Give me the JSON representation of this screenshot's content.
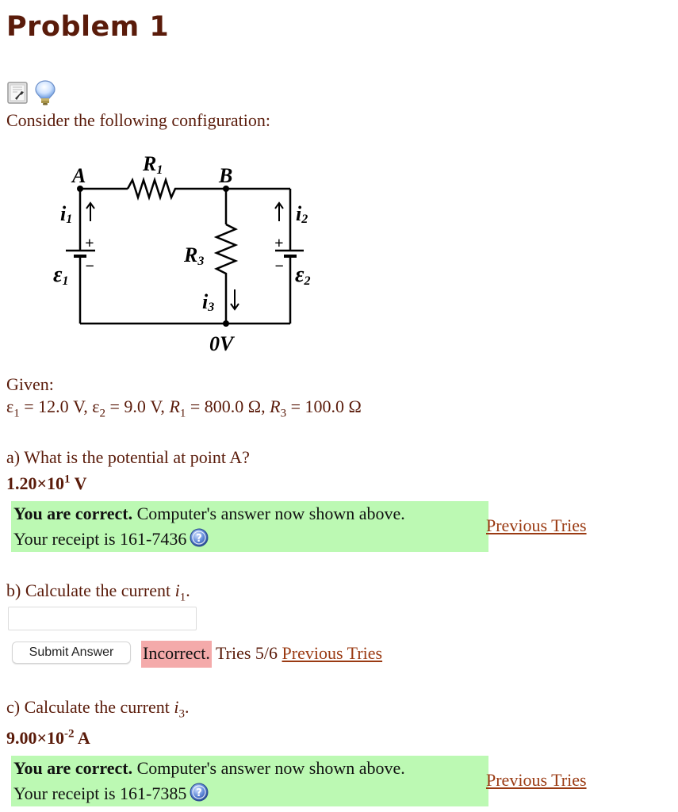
{
  "page": {
    "title": "Problem 1",
    "icons": [
      "tools-icon",
      "lightbulb-hint-icon"
    ],
    "intro": "Consider the following configuration:"
  },
  "circuit": {
    "labels": {
      "node_a": "A",
      "node_b": "B",
      "r1": "R",
      "r1_sub": "1",
      "r3": "R",
      "r3_sub": "3",
      "i1": "i",
      "i1_sub": "1",
      "i2": "i",
      "i2_sub": "2",
      "i3": "i",
      "i3_sub": "3",
      "e1": "ε",
      "e1_sub": "1",
      "e2": "ε",
      "e2_sub": "2",
      "ground": "0V",
      "plus": "+",
      "minus": "−"
    }
  },
  "given": {
    "label": "Given:",
    "values": [
      {
        "sym": "ε",
        "sub": "1",
        "rest": " = 12.0 V, "
      },
      {
        "sym": "ε",
        "sub": "2",
        "rest": " = 9.0 V, "
      },
      {
        "sym": "R",
        "sub": "1",
        "rest": " = 800.0 Ω, "
      },
      {
        "sym": "R",
        "sub": "3",
        "rest": " = 100.0 Ω"
      }
    ]
  },
  "questions": {
    "a": {
      "prompt": "a) What is the potential at point A?",
      "answer_mantissa": "1.20×10",
      "answer_exp": "1",
      "answer_unit": " V",
      "feedback_bold": "You are correct.",
      "feedback_text": " Computer's answer now shown above.",
      "receipt": "Your receipt is 161-7436",
      "previous_tries": "Previous Tries"
    },
    "b": {
      "prompt_pre": "b) Calculate the current ",
      "prompt_var": "i",
      "prompt_sub": "1",
      "prompt_post": ".",
      "input_value": "",
      "submit_label": "Submit Answer",
      "status": "Incorrect.",
      "tries": " Tries 5/6 ",
      "previous_tries": "Previous Tries"
    },
    "c": {
      "prompt_pre": "c) Calculate the current ",
      "prompt_var": "i",
      "prompt_sub": "3",
      "prompt_post": ".",
      "answer_mantissa": "9.00×10",
      "answer_exp": "-2",
      "answer_unit": " A",
      "feedback_bold": "You are correct.",
      "feedback_text": " Computer's answer now shown above.",
      "receipt": "Your receipt is 161-7385",
      "previous_tries": "Previous Tries"
    }
  },
  "colors": {
    "text": "#5a1b0a",
    "correct_bg": "#bcf9b3",
    "incorrect_bg": "#f4aaaa",
    "link": "#9a3a12"
  }
}
